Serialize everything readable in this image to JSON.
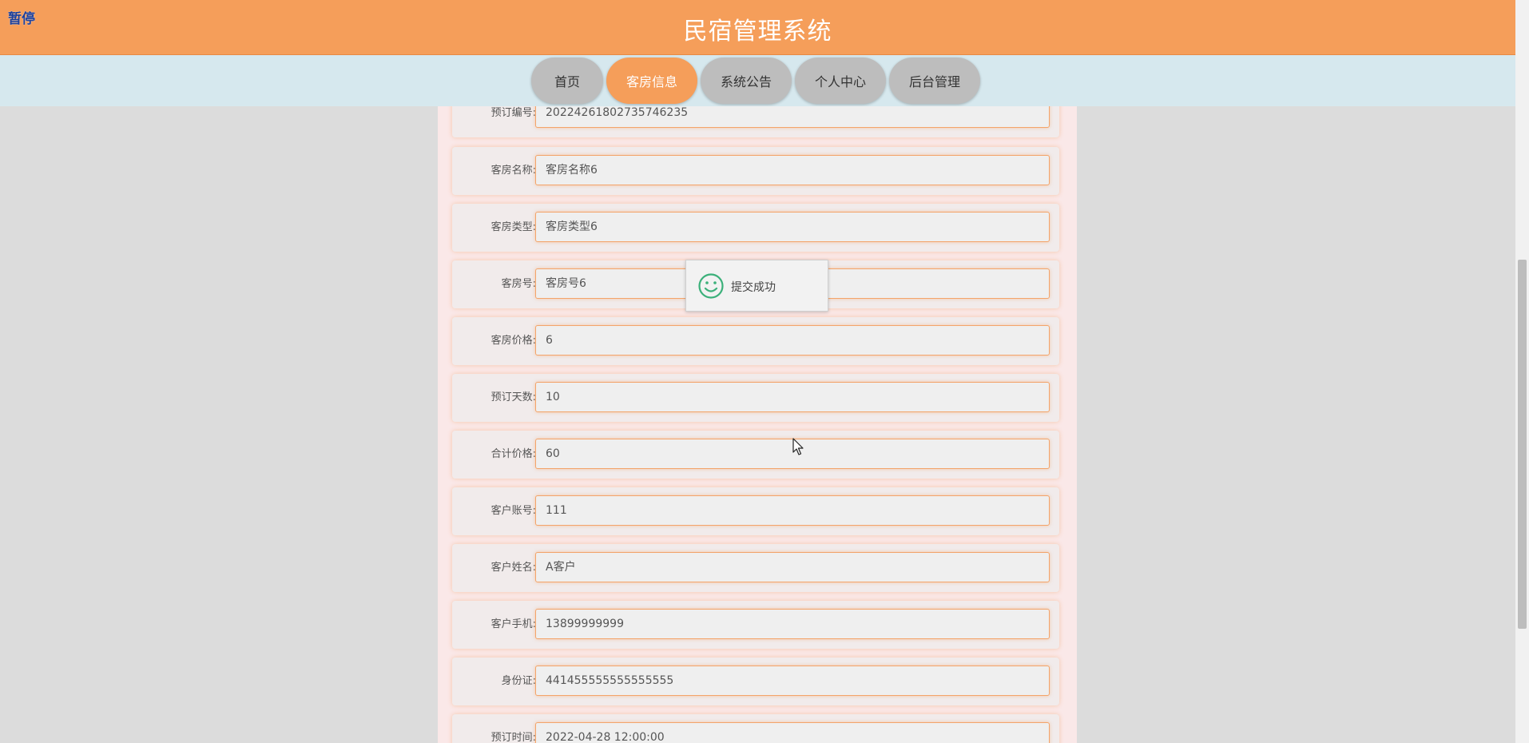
{
  "overlay": {
    "pause_label": "暂停"
  },
  "header": {
    "title": "民宿管理系统"
  },
  "nav": {
    "items": [
      {
        "label": "首页"
      },
      {
        "label": "客房信息"
      },
      {
        "label": "系统公告"
      },
      {
        "label": "个人中心"
      },
      {
        "label": "后台管理"
      }
    ],
    "active": "客房信息"
  },
  "form": {
    "fields": [
      {
        "label": "预订编号:",
        "value": "20224261802735746235"
      },
      {
        "label": "客房名称:",
        "value": "客房名称6"
      },
      {
        "label": "客房类型:",
        "value": "客房类型6"
      },
      {
        "label": "客房号:",
        "value": "客房号6"
      },
      {
        "label": "客房价格:",
        "value": "6"
      },
      {
        "label": "预订天数:",
        "value": "10"
      },
      {
        "label": "合计价格:",
        "value": "60"
      },
      {
        "label": "客户账号:",
        "value": "111"
      },
      {
        "label": "客户姓名:",
        "value": "A客户"
      },
      {
        "label": "客户手机:",
        "value": "13899999999"
      },
      {
        "label": "身份证:",
        "value": "441455555555555555"
      },
      {
        "label": "预订时间:",
        "value": "2022-04-28 12:00:00"
      }
    ]
  },
  "toast": {
    "message": "提交成功",
    "icon": "smile-icon"
  },
  "colors": {
    "accent": "#f59e5a",
    "nav_bg": "#d6e8ee",
    "nav_inactive": "#bdbdbd",
    "toast_icon": "#3bb07a"
  }
}
